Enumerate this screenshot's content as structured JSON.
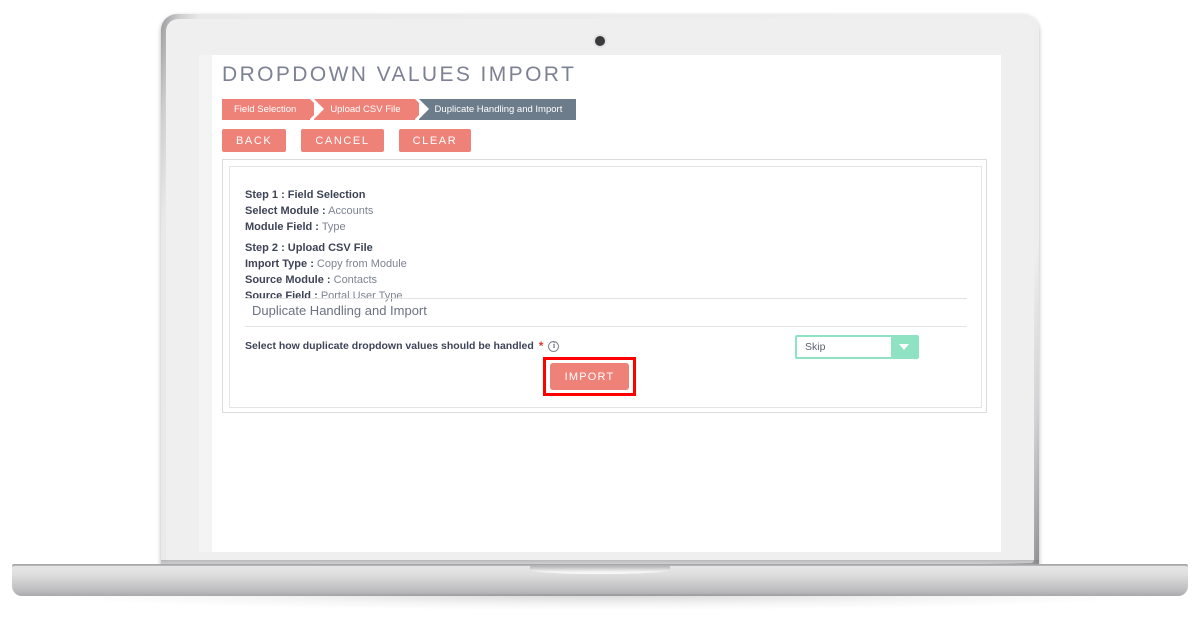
{
  "page": {
    "title": "DROPDOWN VALUES IMPORT"
  },
  "breadcrumb": {
    "steps": [
      {
        "label": "Field Selection",
        "state": "completed"
      },
      {
        "label": "Upload CSV File",
        "state": "completed"
      },
      {
        "label": "Duplicate Handling and Import",
        "state": "active"
      }
    ]
  },
  "actions": {
    "back_label": "BACK",
    "cancel_label": "CANCEL",
    "clear_label": "CLEAR"
  },
  "summary": {
    "step1": {
      "heading": "Step 1 : Field Selection",
      "rows": [
        {
          "key": "Select Module :",
          "value": "Accounts"
        },
        {
          "key": "Module Field :",
          "value": "Type"
        }
      ]
    },
    "step2": {
      "heading": "Step 2 : Upload CSV File",
      "rows": [
        {
          "key": "Import Type :",
          "value": "Copy from Module"
        },
        {
          "key": "Source Module :",
          "value": "Contacts"
        },
        {
          "key": "Source Field :",
          "value": "Portal User Type"
        }
      ]
    }
  },
  "section": {
    "heading": "Duplicate Handling and Import"
  },
  "field": {
    "label": "Select how duplicate dropdown values should be handled",
    "required_marker": "*",
    "info_icon_glyph": "i",
    "info_icon_name": "info-icon"
  },
  "duplicate_select": {
    "value": "Skip",
    "arrow_icon": "chevron-down-icon"
  },
  "import": {
    "label": "IMPORT",
    "highlighted": true
  },
  "colors": {
    "coral": "#ef8278",
    "slate": "#6d7c8b",
    "mint": "#8fe3c2",
    "highlight_red": "#ff0000",
    "title_text": "#7c8193",
    "body_text": "#3d4457",
    "muted_text": "#7d8492",
    "required_red": "#e03b34"
  },
  "device": {
    "type": "laptop-mockup",
    "webcam": "webcam-dot"
  }
}
